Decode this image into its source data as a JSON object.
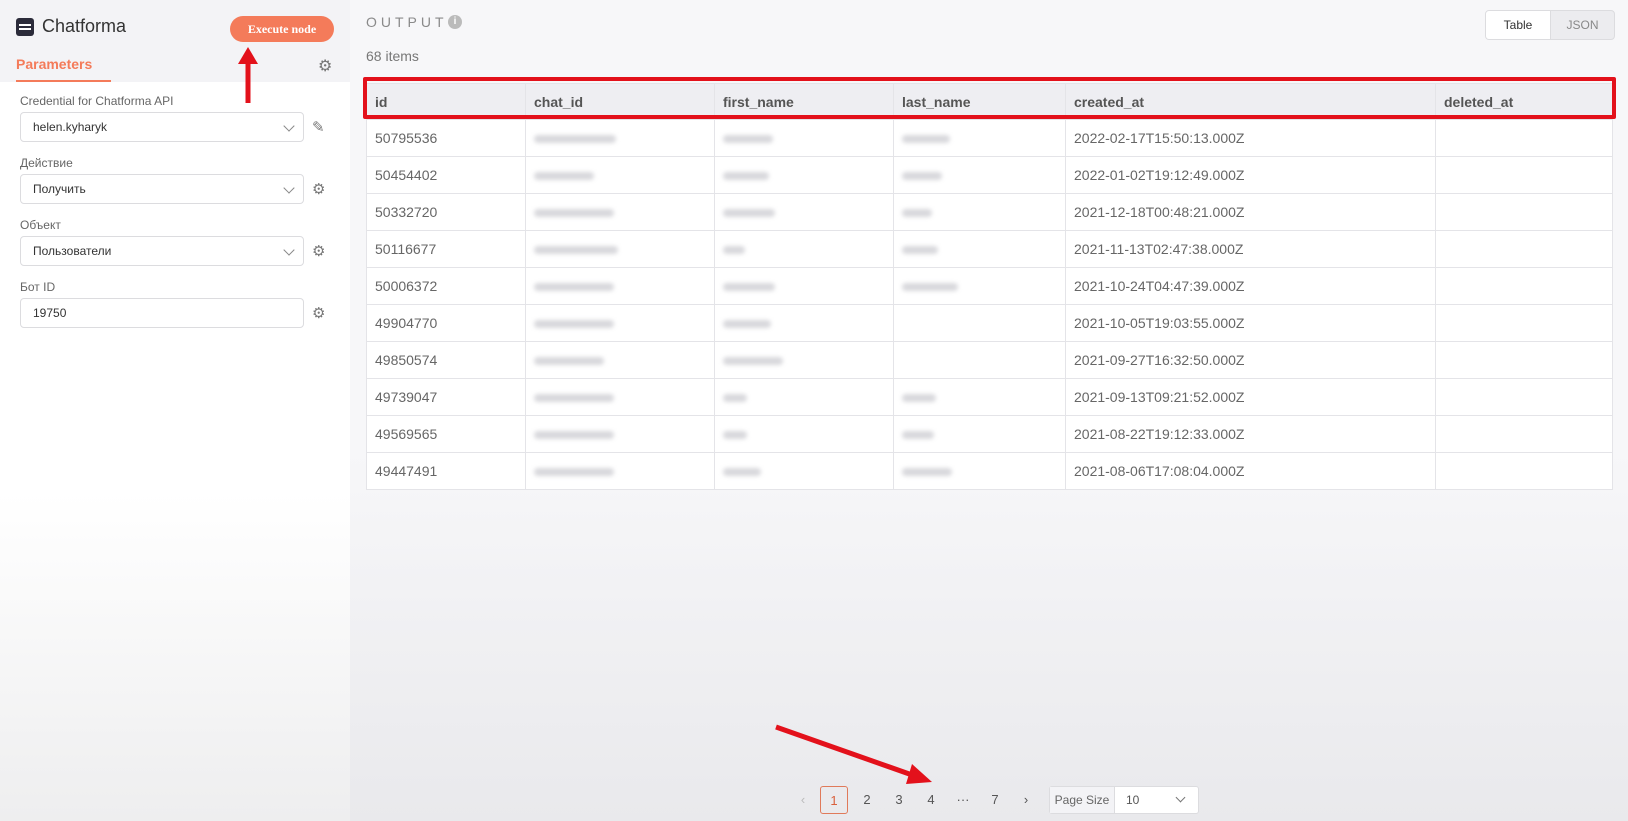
{
  "node": {
    "title": "Chatforma",
    "execute_label": "Execute node",
    "tab_parameters": "Parameters"
  },
  "fields": {
    "credential_label": "Credential for Chatforma API",
    "credential_value": "helen.kyharyk",
    "action_label": "Действие",
    "action_value": "Получить",
    "object_label": "Объект",
    "object_value": "Пользователи",
    "bot_label": "Бот ID",
    "bot_value": "19750"
  },
  "output": {
    "title": "OUTPUT",
    "count": "68 items",
    "view_table": "Table",
    "view_json": "JSON",
    "columns": [
      "id",
      "chat_id",
      "first_name",
      "last_name",
      "created_at",
      "deleted_at"
    ],
    "rows": [
      {
        "id": "50795536",
        "created_at": "2022-02-17T15:50:13.000Z"
      },
      {
        "id": "50454402",
        "created_at": "2022-01-02T19:12:49.000Z"
      },
      {
        "id": "50332720",
        "created_at": "2021-12-18T00:48:21.000Z"
      },
      {
        "id": "50116677",
        "created_at": "2021-11-13T02:47:38.000Z"
      },
      {
        "id": "50006372",
        "created_at": "2021-10-24T04:47:39.000Z"
      },
      {
        "id": "49904770",
        "created_at": "2021-10-05T19:03:55.000Z"
      },
      {
        "id": "49850574",
        "created_at": "2021-09-27T16:32:50.000Z"
      },
      {
        "id": "49739047",
        "created_at": "2021-09-13T09:21:52.000Z"
      },
      {
        "id": "49569565",
        "created_at": "2021-08-22T19:12:33.000Z"
      },
      {
        "id": "49447491",
        "created_at": "2021-08-06T17:08:04.000Z"
      }
    ]
  },
  "pagination": {
    "pages": [
      "1",
      "2",
      "3",
      "4",
      "···",
      "7"
    ],
    "page_size_label": "Page Size",
    "page_size_value": "10"
  },
  "colors": {
    "accent": "#f47b5a",
    "annotation": "#e3111b"
  }
}
